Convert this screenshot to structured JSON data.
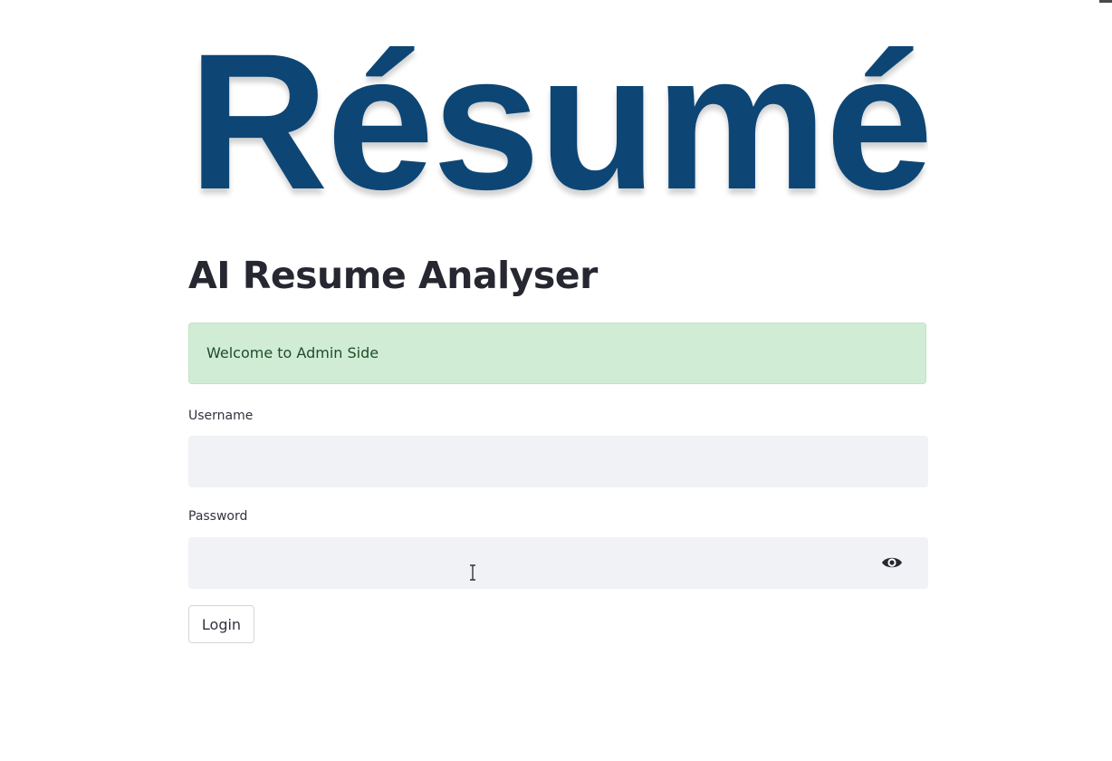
{
  "logo": {
    "text": "Résumé",
    "color": "#0d4675"
  },
  "header": {
    "title": "AI Resume Analyser"
  },
  "alert": {
    "message": "Welcome to Admin Side",
    "background": "#d1ecd4",
    "text_color": "#1e4d2b"
  },
  "form": {
    "username": {
      "label": "Username",
      "value": "",
      "placeholder": ""
    },
    "password": {
      "label": "Password",
      "value": "",
      "placeholder": "",
      "toggle_icon": "eye-icon"
    },
    "submit_label": "Login"
  },
  "colors": {
    "input_background": "#f0f2f6",
    "text": "#31333f",
    "title": "#262730"
  }
}
